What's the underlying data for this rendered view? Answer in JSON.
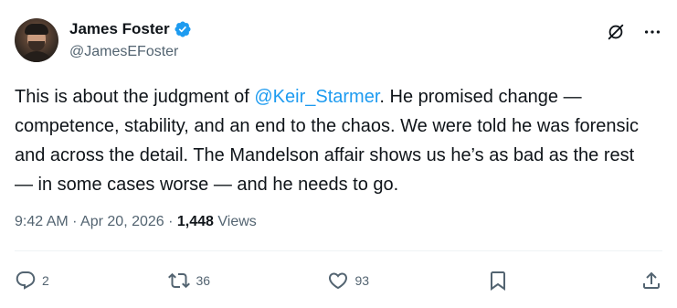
{
  "author": {
    "display_name": "James Foster",
    "handle": "@JamesEFoster",
    "verified": true,
    "verified_color": "#1d9bf0"
  },
  "header_icons": [
    "grok-icon",
    "more-icon"
  ],
  "tweet": {
    "text_before": "This is about the judgment of ",
    "mention": "@Keir_Starmer",
    "text_after": ". He promised change — competence, stability, and an end to the chaos. We were told he was forensic and across the detail. The Mandelson affair shows us he’s as bad as the rest — in some cases worse — and he needs to go."
  },
  "meta": {
    "time": "9:42 AM",
    "sep1": " · ",
    "date": "Apr 20, 2026",
    "sep2": " · ",
    "views_count": "1,448",
    "views_label": " Views"
  },
  "actions": {
    "reply_count": "2",
    "repost_count": "36",
    "like_count": "93"
  },
  "colors": {
    "text": "#0f1419",
    "secondary": "#536471",
    "accent": "#1d9bf0",
    "divider": "#eff3f4"
  }
}
